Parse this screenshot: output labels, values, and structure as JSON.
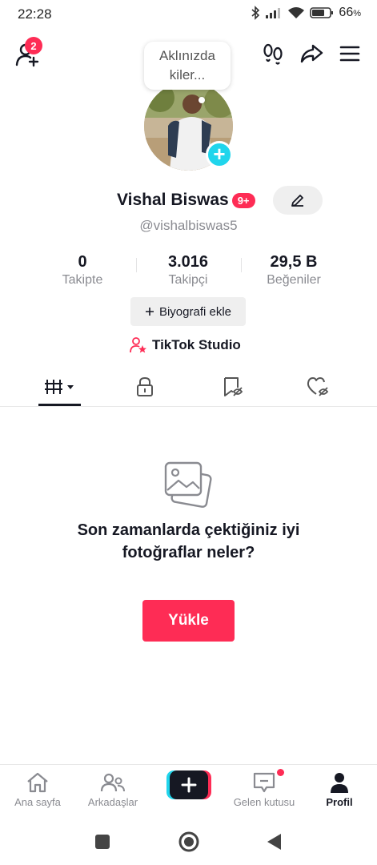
{
  "status": {
    "time": "22:28",
    "battery": "66",
    "battery_unit": "%"
  },
  "topbar": {
    "friend_requests": "2"
  },
  "bubble": {
    "text": "Aklınızda kiler..."
  },
  "profile": {
    "display_name": "Vishal Biswas",
    "name_badge": "9+",
    "username": "@vishalbiswas5"
  },
  "stats": [
    {
      "value": "0",
      "label": "Takipte"
    },
    {
      "value": "3.016",
      "label": "Takipçi"
    },
    {
      "value": "29,5 B",
      "label": "Beğeniler"
    }
  ],
  "bio_button": "Biyografi ekle",
  "studio_label": "TikTok Studio",
  "tabs": [
    {
      "icon": "grid-videos-icon",
      "active": true
    },
    {
      "icon": "lock-icon",
      "active": false
    },
    {
      "icon": "bookmark-icon",
      "active": false
    },
    {
      "icon": "liked-heart-icon",
      "active": false
    }
  ],
  "empty_state": {
    "title": "Son zamanlarda çektiğiniz iyi fotoğraflar neler?",
    "button": "Yükle"
  },
  "bottom_nav": [
    {
      "label": "Ana sayfa",
      "icon": "home-icon"
    },
    {
      "label": "Arkadaşlar",
      "icon": "friends-icon"
    },
    {
      "label": "",
      "icon": "create-plus-icon"
    },
    {
      "label": "Gelen kutusu",
      "icon": "inbox-icon"
    },
    {
      "label": "Profil",
      "icon": "profile-icon"
    }
  ],
  "colors": {
    "accent": "#fe2c55",
    "cyan": "#20d5ec",
    "text": "#161823",
    "muted": "#8a8b91"
  }
}
